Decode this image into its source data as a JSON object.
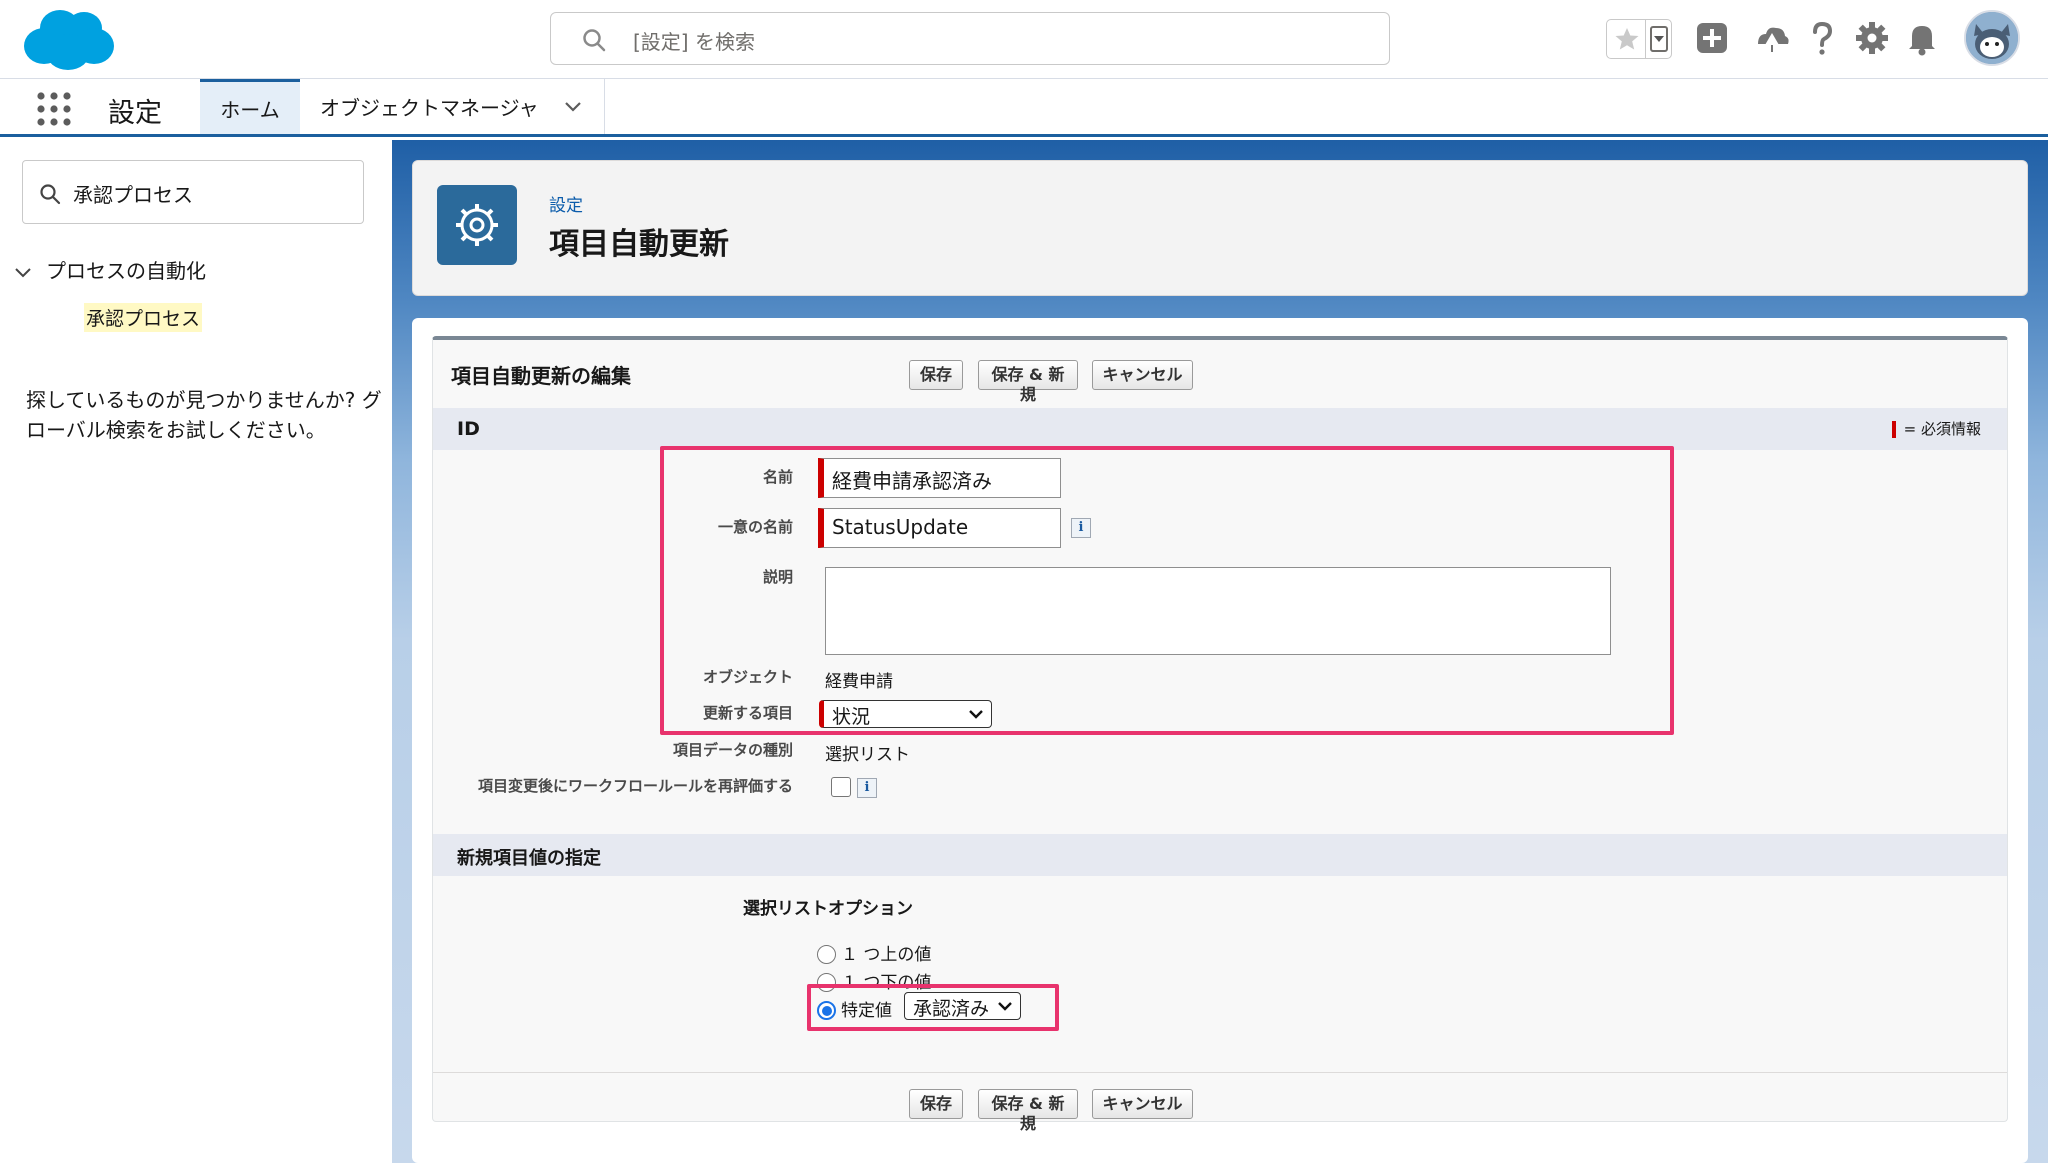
{
  "header": {
    "search_placeholder": "[設定] を検索",
    "colors": {
      "brand": "#00a1e0",
      "accent": "#1b5f9e",
      "highlight": "#e8336d",
      "required": "#cc0000"
    },
    "icons": [
      "salesforce-cloud-logo",
      "search-icon",
      "star-icon",
      "chevron-down-icon",
      "plus-icon",
      "trailhead-icon",
      "help-icon",
      "gear-icon",
      "bell-icon",
      "avatar"
    ]
  },
  "nav": {
    "app_name": "設定",
    "tabs": [
      {
        "label": "ホーム",
        "active": true
      },
      {
        "label": "オブジェクトマネージャ",
        "active": false
      }
    ]
  },
  "sidebar": {
    "quickfind_value": "承認プロセス",
    "tree_node": "プロセスの自動化",
    "tree_leaf": "承認プロセス",
    "not_found_text": "探しているものが見つかりませんか? グローバル検索をお試しください。"
  },
  "page": {
    "breadcrumb": "設定",
    "title": "項目自動更新"
  },
  "form": {
    "title": "項目自動更新の編集",
    "buttons": {
      "save": "保存",
      "save_new": "保存 & 新規",
      "cancel": "キャンセル"
    },
    "section_id": "ID",
    "required_legend": "= 必須情報",
    "fields": {
      "name_label": "名前",
      "name_value": "経費申請承認済み",
      "unique_name_label": "一意の名前",
      "unique_name_value": "StatusUpdate",
      "description_label": "説明",
      "description_value": "",
      "object_label": "オブジェクト",
      "object_value": "経費申請",
      "field_to_update_label": "更新する項目",
      "field_to_update_value": "状況",
      "field_data_type_label": "項目データの種別",
      "field_data_type_value": "選択リスト",
      "reevaluate_label": "項目変更後にワークフロールールを再評価する",
      "reevaluate_checked": false
    },
    "section_new_value": "新規項目値の指定",
    "picklist_options_label": "選択リストオプション",
    "radio_options": [
      {
        "label": "１ つ上の値",
        "checked": false
      },
      {
        "label": "１ つ下の値",
        "checked": false
      },
      {
        "label": "特定値",
        "checked": true
      }
    ],
    "specific_value": "承認済み"
  }
}
